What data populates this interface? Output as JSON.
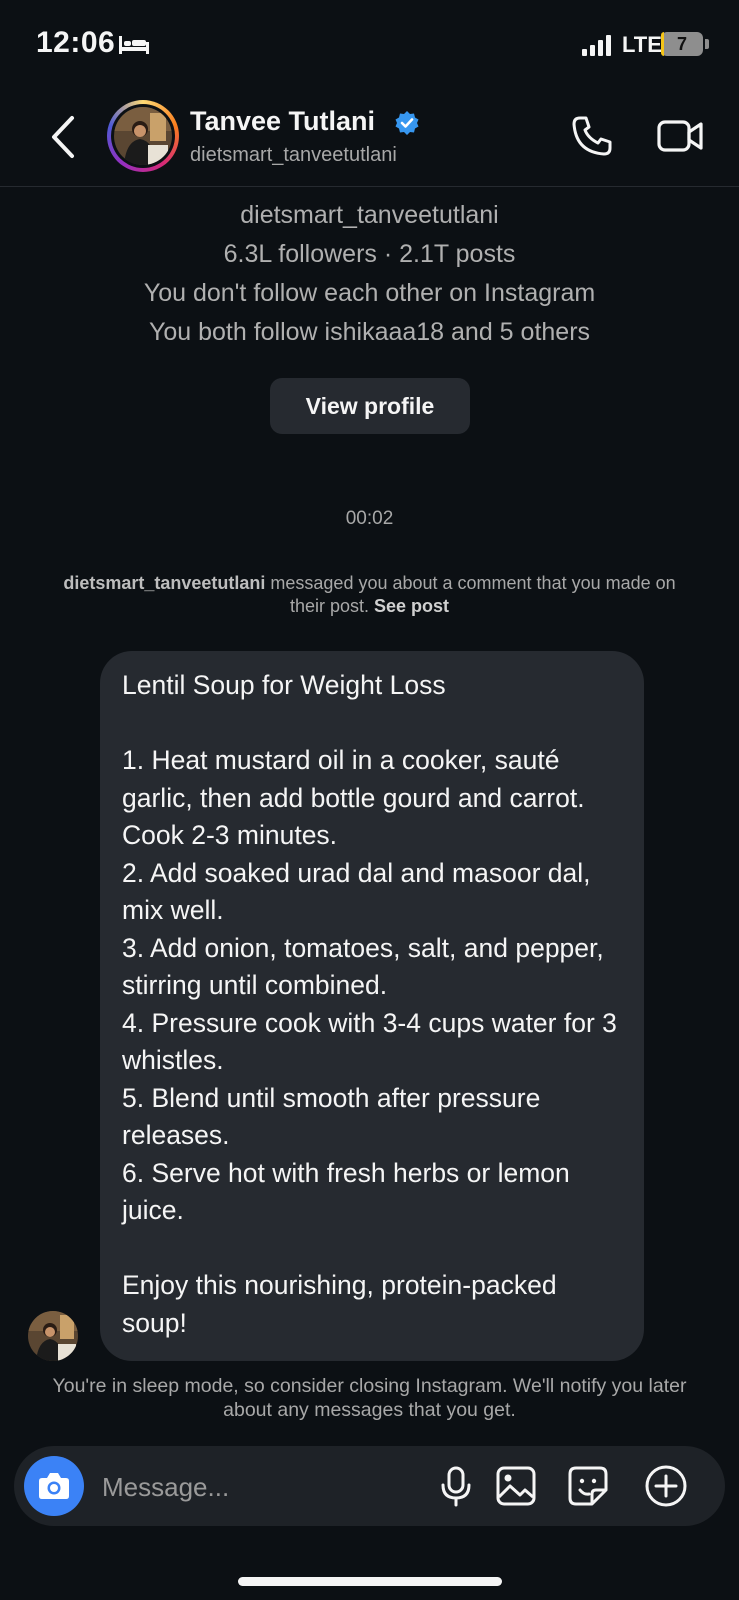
{
  "status_bar": {
    "time": "12:06",
    "network": "LTE",
    "battery_level": "7",
    "battery_fraction": 0.07
  },
  "header": {
    "name": "Tanvee Tutlani",
    "handle": "dietsmart_tanveetutlani",
    "icons": [
      "back-chevron-icon",
      "verified-badge-icon",
      "phone-icon",
      "video-camera-icon"
    ]
  },
  "profile_summary": {
    "handle": "dietsmart_tanveetutlani",
    "stats": "6.3L followers · 2.1T posts",
    "follow_status": "You don't follow each other on Instagram",
    "mutuals": "You both follow ishikaaa18 and 5 others",
    "view_profile_label": "View profile"
  },
  "thread": {
    "timestamp": "00:02",
    "context_user": "dietsmart_tanveetutlani",
    "context_text": " messaged you about a comment that you made on their post. ",
    "see_post_label": "See post",
    "message": "Lentil Soup for Weight Loss\n\n1. Heat mustard oil in a cooker, sauté garlic, then add bottle gourd and carrot. Cook 2-3 minutes.\n2. Add soaked urad dal and masoor dal, mix well.\n3. Add onion, tomatoes, salt, and pepper, stirring until combined.\n4. Pressure cook with 3-4 cups water for 3 whistles.\n5. Blend until smooth after pressure releases.\n6. Serve hot with fresh herbs or lemon juice.\n\nEnjoy this nourishing, protein-packed soup!",
    "sleep_mode_note": "You're in sleep mode, so consider closing Instagram. We'll notify you later about any messages that you get."
  },
  "composer": {
    "placeholder": "Message...",
    "icons": [
      "camera-icon",
      "microphone-icon",
      "gallery-icon",
      "sticker-icon",
      "plus-icon"
    ]
  },
  "colors": {
    "background": "#0c1014",
    "bubble": "#262a30",
    "accent_blue": "#3b82f6",
    "verified": "#3797f0"
  }
}
